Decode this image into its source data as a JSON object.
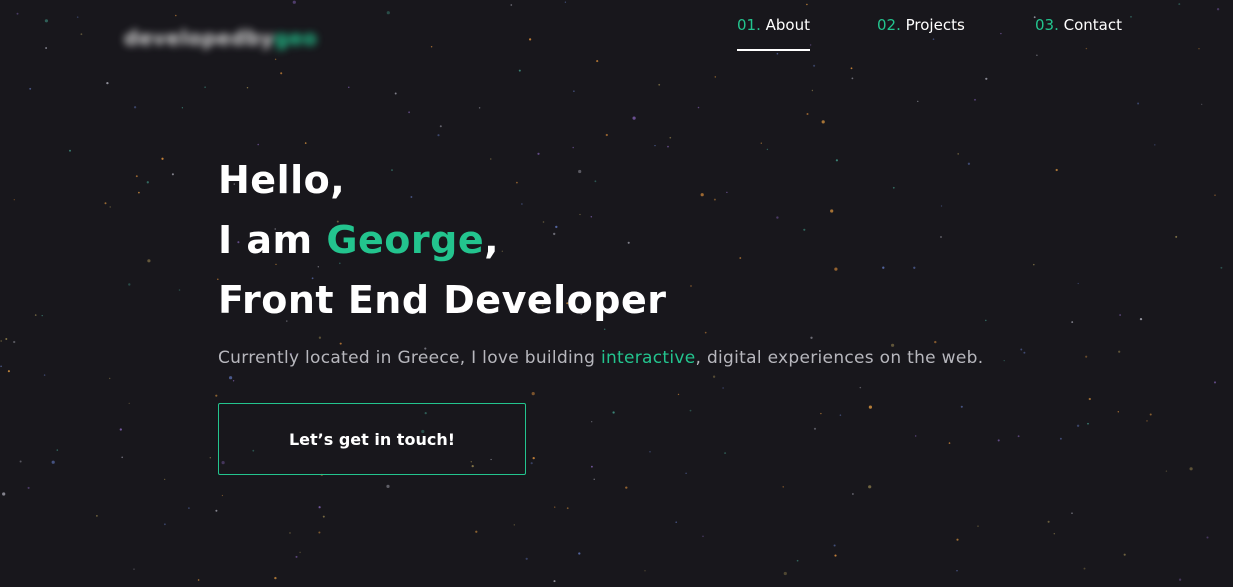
{
  "brand": {
    "logo_text": "developedby",
    "logo_accent": "geo"
  },
  "nav": {
    "items": [
      {
        "number": "01.",
        "label": "About",
        "active": true
      },
      {
        "number": "02.",
        "label": "Projects",
        "active": false
      },
      {
        "number": "03.",
        "label": "Contact",
        "active": false
      }
    ]
  },
  "hero": {
    "line1": "Hello,",
    "line2_prefix": "I am ",
    "line2_name": "George",
    "line2_suffix": ",",
    "line3": "Front End Developer",
    "subtitle_before": "Currently located in Greece, I love building ",
    "subtitle_highlight": "interactive",
    "subtitle_after": ", digital experiences on the web.",
    "cta_label": "Let’s get in touch!"
  },
  "colors": {
    "background": "#18171c",
    "accent": "#23c48e",
    "text": "#ffffff",
    "muted_text": "#b7b7bd"
  },
  "icons": {
    "background_particles": "starfield-particles"
  }
}
